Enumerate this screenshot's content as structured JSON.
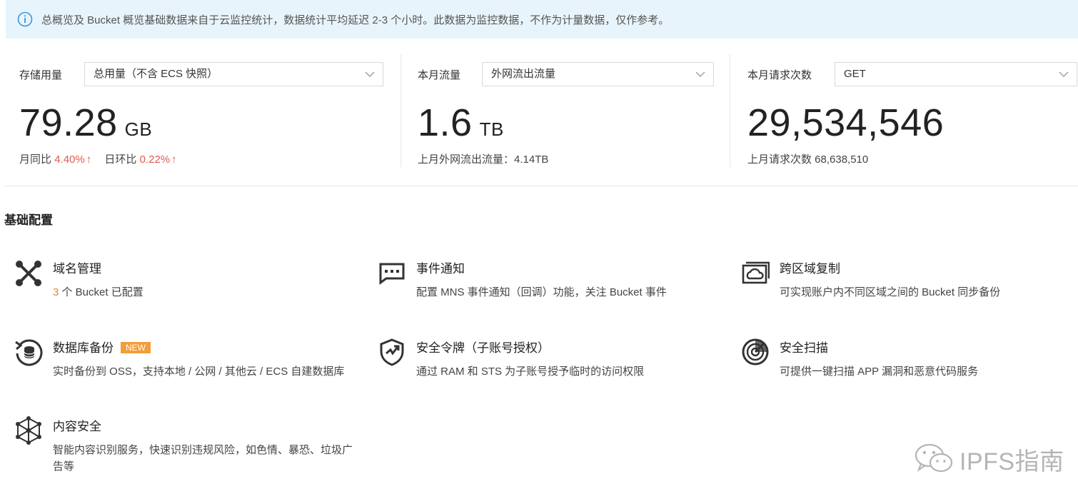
{
  "notice": {
    "text": "总概览及 Bucket 概览基础数据来自于云监控统计，数据统计平均延迟 2-3 个小时。此数据为监控数据，不作为计量数据，仅作参考。"
  },
  "stats": {
    "storage": {
      "label": "存储用量",
      "select_value": "总用量（不含 ECS 快照）",
      "value": "79.28",
      "unit": "GB",
      "mom_label": "月同比",
      "mom_value": "4.40%",
      "dod_label": "日环比",
      "dod_value": "0.22%"
    },
    "traffic": {
      "label": "本月流量",
      "select_value": "外网流出流量",
      "value": "1.6",
      "unit": "TB",
      "sub": "上月外网流出流量：4.14TB"
    },
    "requests": {
      "label": "本月请求次数",
      "select_value": "GET",
      "value": "29,534,546",
      "sub": "上月请求次数 68,638,510"
    }
  },
  "section": {
    "title": "基础配置"
  },
  "cards": {
    "domain": {
      "title": "域名管理",
      "count": "3",
      "desc": " 个 Bucket 已配置"
    },
    "event": {
      "title": "事件通知",
      "desc": "配置 MNS 事件通知（回调）功能，关注 Bucket 事件"
    },
    "replication": {
      "title": "跨区域复制",
      "desc": "可实现账户内不同区域之间的 Bucket 同步备份"
    },
    "db_backup": {
      "title": "数据库备份",
      "badge": "NEW",
      "desc": "实时备份到 OSS，支持本地 / 公网 / 其他云 / ECS 自建数据库"
    },
    "sts": {
      "title": "安全令牌（子账号授权）",
      "desc": "通过 RAM 和 STS 为子账号授予临时的访问权限"
    },
    "scan": {
      "title": "安全扫描",
      "desc": "可提供一键扫描 APP 漏洞和恶意代码服务"
    },
    "content": {
      "title": "内容安全",
      "desc": "智能内容识别服务，快速识别违规风险，如色情、暴恐、垃圾广告等"
    }
  },
  "watermark": {
    "text": "IPFS指南"
  },
  "colors": {
    "notice_bg": "#e8f4fb",
    "accent_red": "#e05a4e",
    "badge": "#f39d3a",
    "link_orange": "#e08a2c"
  }
}
